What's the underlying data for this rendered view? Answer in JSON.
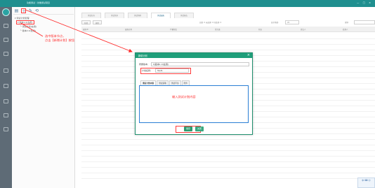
{
  "app": {
    "title": "功能测试｜欣雅测试项目",
    "window_controls": "— □ ×"
  },
  "tree": {
    "toolbar": {
      "icons": [
        "folder-icon",
        "plan-add-icon",
        "edit-icon",
        "refresh-icon"
      ]
    },
    "nodes": [
      {
        "label": "▾ 测试计划管理"
      },
      {
        "label": "▾ 版本1.0(在用)"
      },
      {
        "label": "└ 测试计划(在用)"
      },
      {
        "label": "└ 版本2.0(在用)"
      }
    ]
  },
  "main": {
    "tabs": [
      "测试任务",
      "测试需求",
      "测试用例",
      "测试缺陷",
      "测试报告"
    ],
    "active_tab_index": 3,
    "filter": {
      "buttons": [
        "新增",
        "删除"
      ],
      "stats": "总数: 0   未处理: 0   已处理: 0",
      "select_label": "显示条数:",
      "select_value": "20",
      "search_label": "搜索:"
    },
    "table_headers": [
      "缺陷ID",
      "缺陷名称",
      "严重程度",
      "优先级",
      "状态",
      "提交人",
      "处理人"
    ]
  },
  "annotations": {
    "select_version": "选中版本节点，\n点击【新增计划】按钮",
    "name_attribute": "填定义计划属性",
    "content_hint": "输入测试计划内容"
  },
  "dialog": {
    "title": "新增计划",
    "close": "×",
    "version_label": "所属版本：",
    "version_value": "¥|版本1.0(在用)",
    "name_label": "计划名称：",
    "name_value": "Test1",
    "tabs": [
      "测试计划内容",
      "测试策略",
      "测试环境",
      "附件"
    ],
    "active_tab_index": 0,
    "buttons": {
      "save": "保存",
      "close": "关闭"
    }
  },
  "corner_badge": "中 ⌨ ☺"
}
